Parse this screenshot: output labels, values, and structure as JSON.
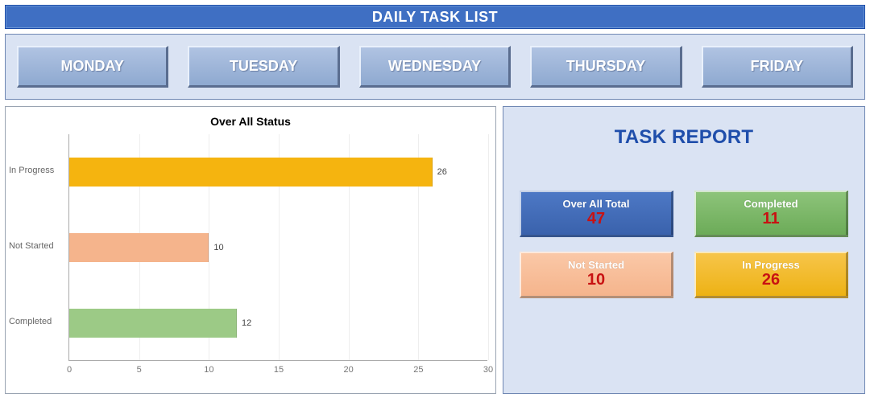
{
  "header": {
    "title": "DAILY TASK LIST"
  },
  "days": [
    "MONDAY",
    "TUESDAY",
    "WEDNESDAY",
    "THURSDAY",
    "FRIDAY"
  ],
  "chart_data": {
    "type": "bar",
    "orientation": "horizontal",
    "title": "Over All Status",
    "categories": [
      "In Progress",
      "Not Started",
      "Completed"
    ],
    "values": [
      26,
      10,
      12
    ],
    "colors": [
      "#f5b40f",
      "#f5b48c",
      "#9cca86"
    ],
    "xlabel": "",
    "ylabel": "",
    "xlim": [
      0,
      30
    ],
    "ticks": [
      0,
      5,
      10,
      15,
      20,
      25,
      30
    ]
  },
  "report": {
    "title": "TASK REPORT",
    "cards": [
      {
        "label": "Over All Total",
        "value": "47",
        "cls": "c-blue"
      },
      {
        "label": "Completed",
        "value": "11",
        "cls": "c-green"
      },
      {
        "label": "Not Started",
        "value": "10",
        "cls": "c-peach"
      },
      {
        "label": "In Progress",
        "value": "26",
        "cls": "c-yellow"
      }
    ]
  }
}
